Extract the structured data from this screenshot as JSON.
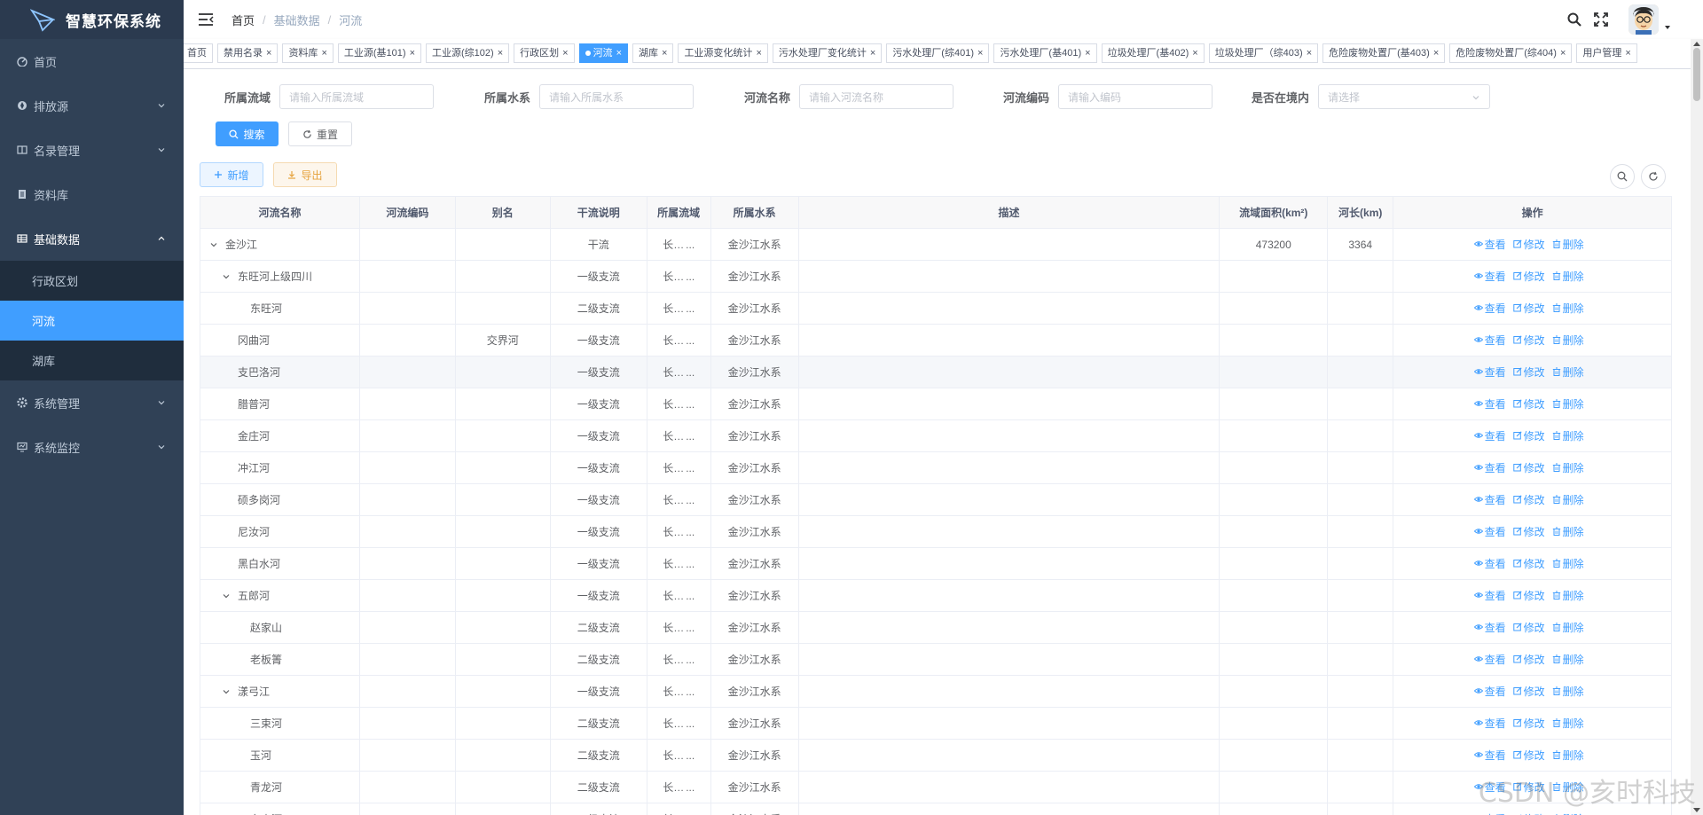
{
  "app": {
    "title": "智慧环保系统"
  },
  "sidebar": {
    "items": [
      {
        "label": "首页",
        "icon": "dashboard-icon"
      },
      {
        "label": "排放源",
        "icon": "compass-icon"
      },
      {
        "label": "名录管理",
        "icon": "book-icon"
      },
      {
        "label": "资料库",
        "icon": "document-icon"
      },
      {
        "label": "基础数据",
        "icon": "table-icon"
      },
      {
        "label": "系统管理",
        "icon": "gear-icon"
      },
      {
        "label": "系统监控",
        "icon": "monitor-icon"
      }
    ],
    "sub_items": [
      {
        "label": "行政区划"
      },
      {
        "label": "河流"
      },
      {
        "label": "湖库"
      }
    ]
  },
  "breadcrumb": {
    "home": "首页",
    "parent": "基础数据",
    "current": "河流"
  },
  "tags": [
    "首页",
    "禁用名录",
    "资料库",
    "工业源(基101)",
    "工业源(综102)",
    "行政区划",
    "河流",
    "湖库",
    "工业源变化统计",
    "污水处理厂变化统计",
    "污水处理厂(综401)",
    "污水处理厂(基401)",
    "垃圾处理厂(基402)",
    "垃圾处理厂（综403)",
    "危险废物处置厂(基403)",
    "危险废物处置厂(综404)",
    "用户管理"
  ],
  "filters": {
    "basin_label": "所属流域",
    "basin_placeholder": "请输入所属流域",
    "system_label": "所属水系",
    "system_placeholder": "请输入所属水系",
    "name_label": "河流名称",
    "name_placeholder": "请输入河流名称",
    "code_label": "河流编码",
    "code_placeholder": "请输入编码",
    "inside_label": "是否在境内",
    "inside_placeholder": "请选择"
  },
  "buttons": {
    "search": "搜索",
    "reset": "重置",
    "add": "新增",
    "export": "导出"
  },
  "table": {
    "headers": {
      "name": "河流名称",
      "code": "河流编码",
      "alias": "别名",
      "main": "干流说明",
      "basin": "所属流域",
      "system": "所属水系",
      "desc": "描述",
      "area": "流域面积(km²)",
      "length": "河长(km)",
      "op": "操作"
    },
    "actions": {
      "view": "查看",
      "edit": "修改",
      "delete": "删除"
    },
    "rows": [
      {
        "name": "金沙江",
        "code": "",
        "alias": "",
        "main": "干流",
        "basin": "长江流域",
        "system": "金沙江水系",
        "desc": "",
        "area": "473200",
        "length": "3364"
      },
      {
        "name": "东旺河上级四川",
        "code": "",
        "alias": "",
        "main": "一级支流",
        "basin": "长江流域",
        "system": "金沙江水系",
        "desc": "",
        "area": "",
        "length": ""
      },
      {
        "name": "东旺河",
        "code": "",
        "alias": "",
        "main": "二级支流",
        "basin": "长江流域",
        "system": "金沙江水系",
        "desc": "",
        "area": "",
        "length": ""
      },
      {
        "name": "冈曲河",
        "code": "",
        "alias": "交界河",
        "main": "一级支流",
        "basin": "长江流域",
        "system": "金沙江水系",
        "desc": "",
        "area": "",
        "length": ""
      },
      {
        "name": "支巴洛河",
        "code": "",
        "alias": "",
        "main": "一级支流",
        "basin": "长江流域",
        "system": "金沙江水系",
        "desc": "",
        "area": "",
        "length": ""
      },
      {
        "name": "腊普河",
        "code": "",
        "alias": "",
        "main": "一级支流",
        "basin": "长江流域",
        "system": "金沙江水系",
        "desc": "",
        "area": "",
        "length": ""
      },
      {
        "name": "金庄河",
        "code": "",
        "alias": "",
        "main": "一级支流",
        "basin": "长江流域",
        "system": "金沙江水系",
        "desc": "",
        "area": "",
        "length": ""
      },
      {
        "name": "冲江河",
        "code": "",
        "alias": "",
        "main": "一级支流",
        "basin": "长江流域",
        "system": "金沙江水系",
        "desc": "",
        "area": "",
        "length": ""
      },
      {
        "name": "硕多岗河",
        "code": "",
        "alias": "",
        "main": "一级支流",
        "basin": "长江流域",
        "system": "金沙江水系",
        "desc": "",
        "area": "",
        "length": ""
      },
      {
        "name": "尼汝河",
        "code": "",
        "alias": "",
        "main": "一级支流",
        "basin": "长江流域",
        "system": "金沙江水系",
        "desc": "",
        "area": "",
        "length": ""
      },
      {
        "name": "黑白水河",
        "code": "",
        "alias": "",
        "main": "一级支流",
        "basin": "长江流域",
        "system": "金沙江水系",
        "desc": "",
        "area": "",
        "length": ""
      },
      {
        "name": "五郎河",
        "code": "",
        "alias": "",
        "main": "一级支流",
        "basin": "长江流域",
        "system": "金沙江水系",
        "desc": "",
        "area": "",
        "length": ""
      },
      {
        "name": "赵家山",
        "code": "",
        "alias": "",
        "main": "二级支流",
        "basin": "长江流域",
        "system": "金沙江水系",
        "desc": "",
        "area": "",
        "length": ""
      },
      {
        "name": "老板箐",
        "code": "",
        "alias": "",
        "main": "二级支流",
        "basin": "长江流域",
        "system": "金沙江水系",
        "desc": "",
        "area": "",
        "length": ""
      },
      {
        "name": "漾弓江",
        "code": "",
        "alias": "",
        "main": "一级支流",
        "basin": "长江流域",
        "system": "金沙江水系",
        "desc": "",
        "area": "",
        "length": ""
      },
      {
        "name": "三束河",
        "code": "",
        "alias": "",
        "main": "二级支流",
        "basin": "长江流域",
        "system": "金沙江水系",
        "desc": "",
        "area": "",
        "length": ""
      },
      {
        "name": "玉河",
        "code": "",
        "alias": "",
        "main": "二级支流",
        "basin": "长江流域",
        "system": "金沙江水系",
        "desc": "",
        "area": "",
        "length": ""
      },
      {
        "name": "青龙河",
        "code": "",
        "alias": "",
        "main": "二级支流",
        "basin": "长江流域",
        "system": "金沙江水系",
        "desc": "",
        "area": "",
        "length": ""
      },
      {
        "name": "东山河",
        "code": "",
        "alias": "",
        "main": "二级支流",
        "basin": "长江流域",
        "system": "金沙江水系",
        "desc": "",
        "area": "",
        "length": ""
      }
    ]
  },
  "watermark": "CSDN @亥时科技",
  "colors": {
    "sidebar_bg": "#304156",
    "accent": "#409eff",
    "warning": "#e6a23c"
  }
}
